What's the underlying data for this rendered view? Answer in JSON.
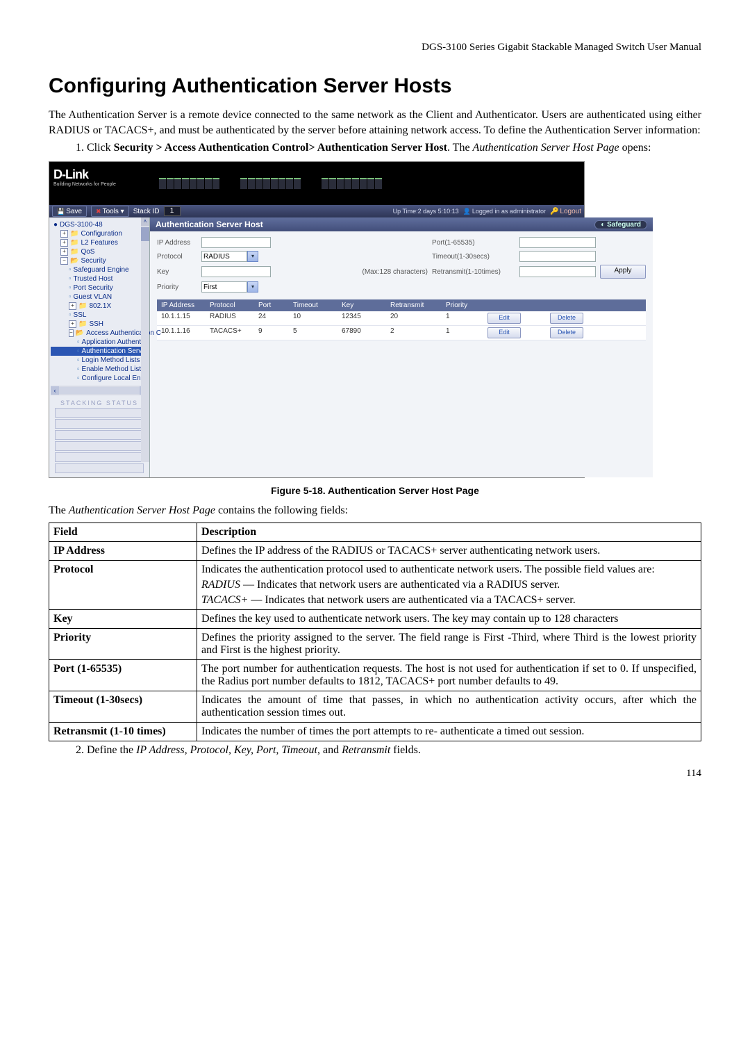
{
  "header": {
    "manual_title": "DGS-3100 Series Gigabit Stackable Managed Switch User Manual"
  },
  "h1": "Configuring Authentication Server Hosts",
  "intro": "The Authentication Server is a remote device connected to the same network as the Client and Authenticator. Users are authenticated using either RADIUS or TACACS+, and must be authenticated by the server before attaining network access. To define the Authentication Server information:",
  "step1_prefix": "Click ",
  "step1_bold": "Security > Access Authentication Control> Authentication Server Host",
  "step1_mid": ". The ",
  "step1_italic": "Authentication Server Host Page",
  "step1_suffix": " opens:",
  "app": {
    "brand": "D-Link",
    "tagline": "Building Networks for People",
    "toolbar": {
      "save": "Save",
      "tools": "Tools ▾",
      "stack_label": "Stack ID",
      "stack_value": "1"
    },
    "status": {
      "uptime": "Up Time:2 days 5:10:13",
      "logged": "Logged in as administrator",
      "logout": "Logout"
    },
    "tree": {
      "root": "DGS-3100-48",
      "configuration": "Configuration",
      "l2": "L2 Features",
      "qos": "QoS",
      "security": "Security",
      "safeguard": "Safeguard Engine",
      "trusted": "Trusted Host",
      "portsec": "Port Security",
      "guestvlan": "Guest VLAN",
      "dot1x": "802.1X",
      "ssl": "SSL",
      "ssh": "SSH",
      "aac": "Access Authentication C",
      "appauth": "Application Authentic",
      "authserv": "Authentication Serve",
      "loginmeth": "Login Method Lists",
      "enablemeth": "Enable Method Lists",
      "conflocal": "Configure Local Enab",
      "stack_status": "STACKING STATUS"
    },
    "panel": {
      "title": "Authentication Server Host",
      "safeguard": "Safeguard",
      "labels": {
        "ip": "IP Address",
        "protocol": "Protocol",
        "key": "Key",
        "priority": "Priority",
        "port": "Port(1-65535)",
        "timeout": "Timeout(1-30secs)",
        "retransmit": "Retransmit(1-10times)",
        "keyhint": "(Max:128 characters)",
        "apply": "Apply"
      },
      "values": {
        "protocol": "RADIUS",
        "priority": "First"
      },
      "cols": {
        "ip": "IP Address",
        "protocol": "Protocol",
        "port": "Port",
        "timeout": "Timeout",
        "key": "Key",
        "retransmit": "Retransmit",
        "priority": "Priority"
      },
      "rows": [
        {
          "ip": "10.1.1.15",
          "protocol": "RADIUS",
          "port": "24",
          "timeout": "10",
          "key": "12345",
          "retransmit": "20",
          "priority": "1",
          "edit": "Edit",
          "delete": "Delete"
        },
        {
          "ip": "10.1.1.16",
          "protocol": "TACACS+",
          "port": "9",
          "timeout": "5",
          "key": "67890",
          "retransmit": "2",
          "priority": "1",
          "edit": "Edit",
          "delete": "Delete"
        }
      ]
    }
  },
  "figcap": "Figure 5-18. Authentication Server Host Page",
  "contains_prefix": "The ",
  "contains_italic": "Authentication Server Host Page",
  "contains_suffix": " contains the following fields:",
  "fields_header": {
    "field": "Field",
    "desc": "Description"
  },
  "fields": {
    "ip": {
      "name": "IP Address",
      "desc": "Defines the IP address of the RADIUS or TACACS+ server authenticating network users."
    },
    "protocol": {
      "name": "Protocol",
      "intro": "Indicates the authentication protocol used to authenticate network users. The possible field values are:",
      "radius_k": "RADIUS",
      "radius_d": " — Indicates that network users are authenticated via a RADIUS server.",
      "tacacs_k": "TACACS+",
      "tacacs_d": " — Indicates that network users are authenticated via a TACACS+ server."
    },
    "key": {
      "name": "Key",
      "desc": "Defines the key used to authenticate network users. The key may contain up to 128 characters"
    },
    "priority": {
      "name": "Priority",
      "desc": "Defines the priority assigned to the server. The field range is First -Third, where Third is the lowest priority and First is the highest priority."
    },
    "port": {
      "name": "Port (1-65535)",
      "desc": "The port number for authentication requests. The host is not used for authentication if set to 0. If unspecified, the Radius port number defaults to 1812, TACACS+ port number defaults to 49."
    },
    "timeout": {
      "name": "Timeout (1-30secs)",
      "desc": "Indicates the amount of time that passes, in which no authentication activity occurs, after which the authentication session times out."
    },
    "retransmit": {
      "name": "Retransmit (1-10 times)",
      "desc": "Indicates the number of times the port attempts to re- authenticate a timed out session."
    }
  },
  "step2_prefix": "Define the ",
  "step2_italic": "IP Address, Protocol, Key, Port, Timeout",
  "step2_mid": ", and ",
  "step2_italic2": "Retransmit",
  "step2_suffix": " fields.",
  "page_number": "114"
}
